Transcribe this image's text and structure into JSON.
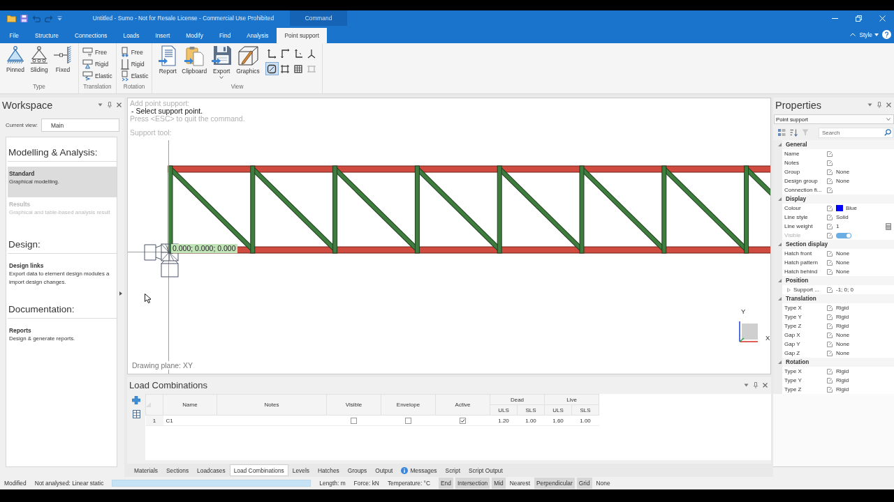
{
  "window": {
    "title": "Untitled - Sumo - Not for Resale License - Commercial Use Prohibited",
    "context_tab": "Command",
    "quick_access": [
      {
        "disabled": false
      },
      {
        "disabled": false
      },
      {
        "disabled": true
      },
      {
        "disabled": true
      },
      {
        "disabled": false
      }
    ]
  },
  "ribbon": {
    "tabs": [
      {
        "label": "File",
        "selected": false
      },
      {
        "label": "Structure",
        "selected": false
      },
      {
        "label": "Connections",
        "selected": false
      },
      {
        "label": "Loads",
        "selected": false
      },
      {
        "label": "Insert",
        "selected": false
      },
      {
        "label": "Modify",
        "selected": false
      },
      {
        "label": "Find",
        "selected": false
      },
      {
        "label": "Analysis",
        "selected": false
      },
      {
        "label": "Point support",
        "selected": true
      }
    ],
    "style_menu": "Style",
    "groups": [
      {
        "title": "Type",
        "kind": "large",
        "buttons": [
          {
            "label": "Pinned"
          },
          {
            "label": "Sliding"
          },
          {
            "label": "Fixed"
          }
        ]
      },
      {
        "title": "Translation",
        "kind": "small",
        "buttons": [
          {
            "label": "Free"
          },
          {
            "label": "Rigid"
          },
          {
            "label": "Elastic"
          }
        ]
      },
      {
        "title": "Rotation",
        "kind": "small",
        "buttons": [
          {
            "label": "Free"
          },
          {
            "label": "Rigid"
          },
          {
            "label": "Elastic"
          }
        ]
      },
      {
        "title": "View",
        "kind": "large",
        "buttons": [
          {
            "label": "Report",
            "dropdown": false
          },
          {
            "label": "Clipboard",
            "dropdown": false
          },
          {
            "label": "Export",
            "dropdown": true
          },
          {
            "label": "Graphics",
            "dropdown": false
          }
        ],
        "tools": [
          {
            "selected": false,
            "disabled": false
          },
          {
            "selected": false,
            "disabled": false
          },
          {
            "selected": false,
            "disabled": false
          },
          {
            "selected": false,
            "disabled": false
          },
          {
            "selected": true,
            "disabled": false
          },
          {
            "selected": false,
            "disabled": false
          },
          {
            "selected": false,
            "disabled": false
          },
          {
            "selected": false,
            "disabled": true
          }
        ]
      }
    ]
  },
  "workspace": {
    "title": "Workspace",
    "current_view_label": "Current view:",
    "current_view": "Main",
    "sections": [
      {
        "heading": "Modelling & Analysis:",
        "items": [
          {
            "title": "Standard",
            "description": [
              "Graphical modelling."
            ],
            "selected": true,
            "disabled": false
          },
          {
            "title": "Results",
            "description": [
              "Graphical and table-based analysis result"
            ],
            "selected": false,
            "disabled": true
          }
        ]
      },
      {
        "heading": "Design:",
        "items": [
          {
            "title": "Design links",
            "description": [
              "Export data to element design modules a",
              "import design changes."
            ],
            "selected": false,
            "disabled": false
          }
        ]
      },
      {
        "heading": "Documentation:",
        "items": [
          {
            "title": "Reports",
            "description": [
              "Design & generate reports."
            ],
            "selected": false,
            "disabled": false
          }
        ]
      }
    ]
  },
  "canvas": {
    "command_lines": [
      {
        "kind": "hint",
        "text": "Add point support:"
      },
      {
        "kind": "prompt",
        "text": "- Select support point."
      },
      {
        "kind": "hint",
        "text": "Press <ESC> to quit the command."
      }
    ],
    "tool_label": "Support tool:",
    "coordinate_label": "0.000; 0.000; 0.000",
    "axis_labels": {
      "y": "Y",
      "x": "X"
    },
    "drawing_plane": "Drawing plane: XY"
  },
  "properties": {
    "title": "Properties",
    "object_type": "Point support",
    "search": {
      "placeholder": "Search"
    },
    "categories": [
      {
        "name": "General",
        "expanded": true,
        "rows": [
          {
            "name": "Name",
            "kind": "text",
            "disabled": false
          },
          {
            "name": "Notes",
            "kind": "text",
            "disabled": false
          },
          {
            "name": "Group",
            "kind": "text",
            "value": "None",
            "disabled": false
          },
          {
            "name": "Design group",
            "kind": "text",
            "value": "None",
            "disabled": false
          },
          {
            "name": "Connection fi...",
            "kind": "text",
            "disabled": false
          }
        ]
      },
      {
        "name": "Display",
        "expanded": true,
        "rows": [
          {
            "name": "Colour",
            "kind": "colour",
            "value": "Blue",
            "color": "#0000ff",
            "disabled": false
          },
          {
            "name": "Line style",
            "kind": "text",
            "value": "Solid",
            "disabled": false
          },
          {
            "name": "Line weight",
            "kind": "number",
            "value": "1",
            "disabled": false
          },
          {
            "name": "Visible",
            "kind": "toggle",
            "on": true,
            "disabled": true
          }
        ]
      },
      {
        "name": "Section display",
        "expanded": true,
        "rows": [
          {
            "name": "Hatch front",
            "kind": "text",
            "value": "None",
            "disabled": false
          },
          {
            "name": "Hatch pattern",
            "kind": "text",
            "value": "None",
            "disabled": false
          },
          {
            "name": "Hatch behind",
            "kind": "text",
            "value": "None",
            "disabled": false
          }
        ]
      },
      {
        "name": "Position",
        "expanded": true,
        "rows": [
          {
            "name": "Support ...",
            "kind": "group",
            "value": "-1; 0; 0",
            "expanded": false,
            "disabled": false
          }
        ]
      },
      {
        "name": "Translation",
        "expanded": true,
        "rows": [
          {
            "name": "Type X",
            "kind": "text",
            "value": "Rigid",
            "disabled": false
          },
          {
            "name": "Type Y",
            "kind": "text",
            "value": "Rigid",
            "disabled": false
          },
          {
            "name": "Type Z",
            "kind": "text",
            "value": "Rigid",
            "disabled": false
          },
          {
            "name": "Gap X",
            "kind": "text",
            "value": "None",
            "disabled": false
          },
          {
            "name": "Gap Y",
            "kind": "text",
            "value": "None",
            "disabled": false
          },
          {
            "name": "Gap Z",
            "kind": "text",
            "value": "None",
            "disabled": false
          }
        ]
      },
      {
        "name": "Rotation",
        "expanded": true,
        "rows": [
          {
            "name": "Type X",
            "kind": "text",
            "value": "Rigid",
            "disabled": false
          },
          {
            "name": "Type Y",
            "kind": "text",
            "value": "Rigid",
            "disabled": false
          },
          {
            "name": "Type Z",
            "kind": "text",
            "value": "Rigid",
            "disabled": false
          }
        ]
      }
    ]
  },
  "load_combinations": {
    "title": "Load Combinations",
    "text_columns": [
      "Name",
      "Notes"
    ],
    "check_columns": [
      "Visible",
      "Envelope",
      "Active"
    ],
    "factor_groups": [
      {
        "name": "Dead",
        "columns": [
          "ULS",
          "SLS"
        ]
      },
      {
        "name": "Live",
        "columns": [
          "ULS",
          "SLS"
        ]
      }
    ],
    "rows": [
      {
        "number": "1",
        "name": "C1",
        "checks": [
          {
            "checked": false
          },
          {
            "checked": false
          },
          {
            "checked": true
          }
        ],
        "factors": [
          "1.20",
          "1.00",
          "1.60",
          "1.00"
        ]
      }
    ]
  },
  "panel_tabs": [
    {
      "label": "Materials",
      "kind": "plain",
      "selected": false
    },
    {
      "label": "Sections",
      "kind": "plain",
      "selected": false
    },
    {
      "label": "Loadcases",
      "kind": "plain",
      "selected": false
    },
    {
      "label": "Load Combinations",
      "kind": "plain",
      "selected": true
    },
    {
      "label": "Levels",
      "kind": "plain",
      "selected": false
    },
    {
      "label": "Hatches",
      "kind": "plain",
      "selected": false
    },
    {
      "label": "Groups",
      "kind": "plain",
      "selected": false
    },
    {
      "label": "Output",
      "kind": "plain",
      "selected": false
    },
    {
      "label": "Messages",
      "kind": "info",
      "selected": false
    },
    {
      "label": "Script",
      "kind": "plain",
      "selected": false
    },
    {
      "label": "Script Output",
      "kind": "plain",
      "selected": false
    }
  ],
  "status_bar": {
    "state": "Modified",
    "analysis": "Not analysed: Linear static",
    "progress": {
      "level": 1
    },
    "units": [
      "Length: m",
      "Force: kN",
      "Temperature: °C"
    ],
    "snaps": [
      {
        "label": "End",
        "on": true
      },
      {
        "label": "Intersection",
        "on": true
      },
      {
        "label": "Mid",
        "on": true
      },
      {
        "label": "Nearest",
        "on": false
      },
      {
        "label": "Perpendicular",
        "on": true
      },
      {
        "label": "Grid",
        "on": true
      },
      {
        "label": "None",
        "on": false
      }
    ]
  }
}
